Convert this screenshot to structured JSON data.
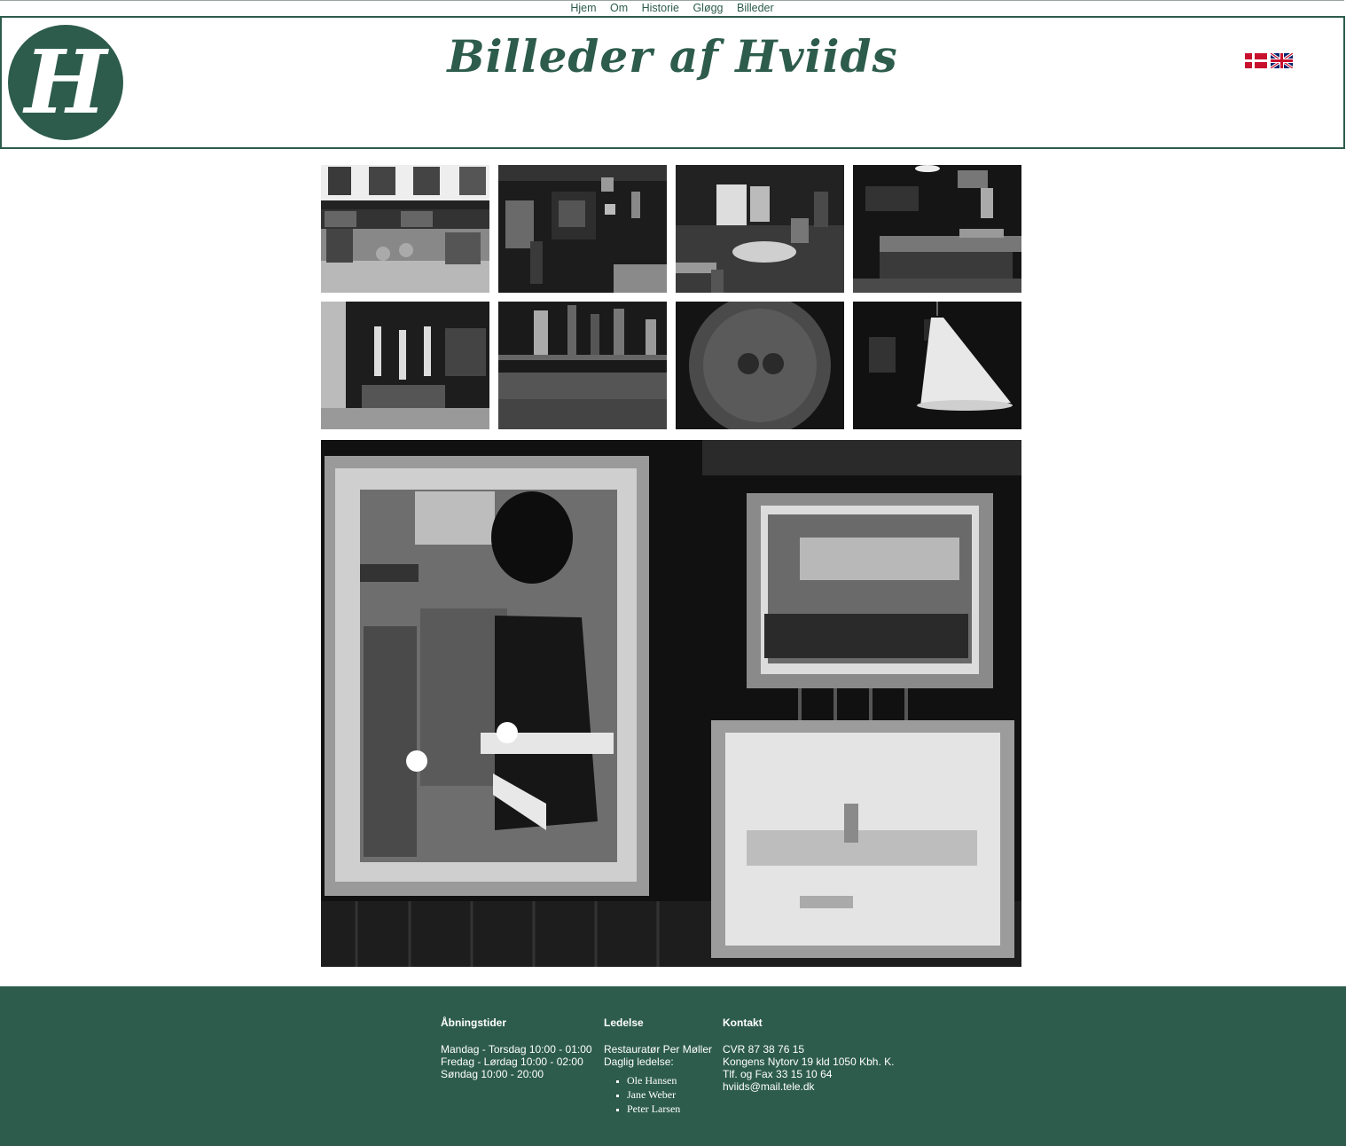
{
  "nav": {
    "items": [
      "Hjem",
      "Om",
      "Historie",
      "Gløgg",
      "Billeder"
    ]
  },
  "header": {
    "logo_letter": "H",
    "title": "Billeder af Hviids"
  },
  "languages": [
    {
      "name": "Dansk",
      "icon": "danish-flag-icon"
    },
    {
      "name": "English",
      "icon": "uk-flag-icon"
    }
  ],
  "gallery": {
    "thumbnails": [
      "facade-photo",
      "bar-room-photo",
      "dining-room-photo",
      "bar-counter-photo",
      "beer-taps-photo",
      "bottles-glasses-photo",
      "round-table-photo",
      "lamp-photo"
    ],
    "main_image": "guard-painting-photo"
  },
  "footer": {
    "opening": {
      "heading": "Åbningstider",
      "lines": [
        "Mandag - Torsdag 10:00 - 01:00",
        "Fredag - Lørdag 10:00 - 02:00",
        "Søndag 10:00 - 20:00"
      ]
    },
    "management": {
      "heading": "Ledelse",
      "lines": [
        "Restauratør Per Møller",
        "Daglig ledelse:"
      ],
      "staff": [
        "Ole Hansen",
        "Jane Weber",
        "Peter Larsen"
      ]
    },
    "contact": {
      "heading": "Kontakt",
      "lines": [
        "CVR 87 38 76 15",
        "Kongens Nytorv 19 kld 1050 Kbh. K.",
        "Tlf. og Fax 33 15 10 64",
        "hviids@mail.tele.dk"
      ]
    }
  },
  "colors": {
    "brand_green": "#2d5c4c",
    "white": "#ffffff"
  }
}
